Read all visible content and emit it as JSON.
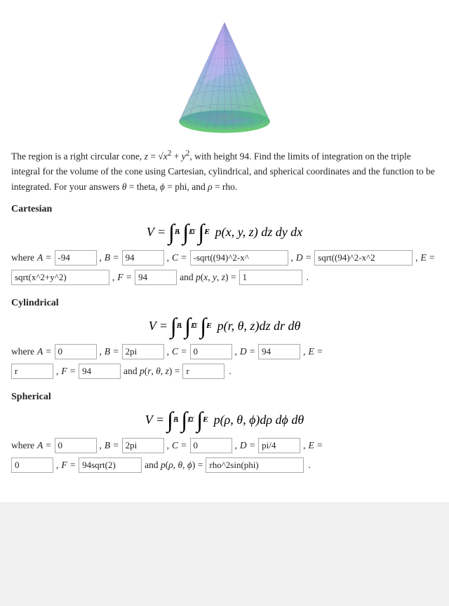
{
  "page": {
    "description": "The region is a right circular cone, z = √(x² + y²), with height 94. Find the limits of integration on the triple integral for the volume of the cone using Cartesian, cylindrical, and spherical coordinates and the function to be integrated. For your answers θ = theta, ϕ = phi, and ρ = rho.",
    "sections": {
      "cartesian": {
        "title": "Cartesian",
        "integral_label": "V =",
        "integrand": "p(x, y, z) dz dy dx",
        "where_label": "where",
        "fields": {
          "A": "-94",
          "B": "94",
          "C": "-sqrt((94)^2-x^",
          "D": "sqrt((94)^2-x^2",
          "E_label": "E =",
          "E_value": "sqrt(x^2+y^2)",
          "F": "94",
          "p_label": "and p(x, y, z) =",
          "p_value": "1"
        }
      },
      "cylindrical": {
        "title": "Cylindrical",
        "integral_label": "V =",
        "integrand": "p(r, θ, z)dz dr dθ",
        "where_label": "where",
        "fields": {
          "A": "0",
          "B": "2pi",
          "C": "0",
          "D": "94",
          "E_label": "E =",
          "E_value": "r",
          "F": "94",
          "p_label": "and p(r, θ, z) =",
          "p_value": "r"
        }
      },
      "spherical": {
        "title": "Spherical",
        "integral_label": "V =",
        "integrand": "p(ρ, θ, ϕ)dρ dϕ dθ",
        "where_label": "where",
        "fields": {
          "A": "0",
          "B": "2pi",
          "C": "0",
          "D": "pi/4",
          "E_label": "E =",
          "E_value": "0",
          "F": "94sqrt(2)",
          "p_label": "and p(ρ, θ, ϕ) =",
          "p_value": "rho^2sin(phi)"
        }
      }
    }
  }
}
